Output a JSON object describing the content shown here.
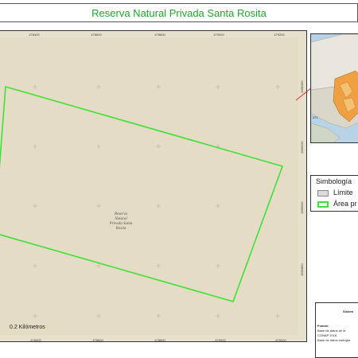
{
  "title": "Reserva Natural Privada Santa Rosita",
  "map": {
    "ticks_top": [
      "478400",
      "478600",
      "478800",
      "479000",
      "479200"
    ],
    "ticks_bottom": [
      "478400",
      "478600",
      "478800",
      "479000",
      "479200"
    ],
    "ticks_right": [
      "1686400",
      "1686200",
      "1686000",
      "1685800"
    ],
    "parcel_label_lines": [
      "Reserva",
      "Natural",
      "Privada Santa",
      "Rosita"
    ],
    "scale_label": "0.2 Kilómetros",
    "parcel_color": "#3fe03a",
    "background_color": "#e4dcc4"
  },
  "legend": {
    "title": "Simbología",
    "items": [
      {
        "label": "Límite",
        "color": "#dcdcdc"
      },
      {
        "label": "Área pr",
        "color": "#3fe03a"
      }
    ]
  },
  "source_box": {
    "heading": "Sistem",
    "fuente_label": "Fuente:",
    "lines": [
      "Base de datos de la",
      "CONAP 2016",
      "Base de datos cartogra"
    ]
  },
  "inset": {
    "label_number": "221",
    "highlight_color": "#f0a040",
    "locator_line_color": "#e03030"
  }
}
